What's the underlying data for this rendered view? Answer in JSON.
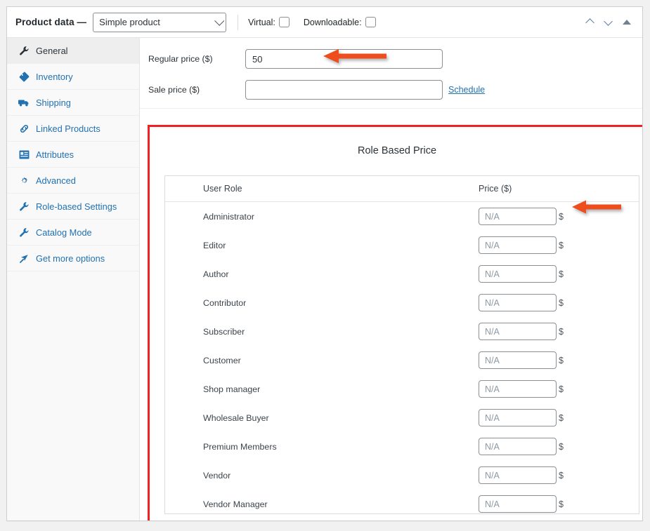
{
  "header": {
    "title": "Product data —",
    "product_type": "Simple product",
    "virtual_label": "Virtual:",
    "virtual_checked": false,
    "downloadable_label": "Downloadable:",
    "downloadable_checked": false,
    "controls": {
      "move_up": "move-up",
      "move_down": "move-down",
      "toggle": "toggle-panel"
    }
  },
  "sidebar": {
    "items": [
      {
        "label": "General",
        "icon": "wrench-icon",
        "active": true
      },
      {
        "label": "Inventory",
        "icon": "tag-icon",
        "active": false
      },
      {
        "label": "Shipping",
        "icon": "truck-icon",
        "active": false
      },
      {
        "label": "Linked Products",
        "icon": "link-icon",
        "active": false
      },
      {
        "label": "Attributes",
        "icon": "attributes-icon",
        "active": false
      },
      {
        "label": "Advanced",
        "icon": "gear-icon",
        "active": false
      },
      {
        "label": "Role-based Settings",
        "icon": "wrench-icon",
        "active": false
      },
      {
        "label": "Catalog Mode",
        "icon": "wrench-icon",
        "active": false
      },
      {
        "label": "Get more options",
        "icon": "cursor-icon",
        "active": false
      }
    ]
  },
  "general": {
    "regular_price_label": "Regular price ($)",
    "regular_price_value": "50",
    "regular_price_placeholder": "",
    "sale_price_label": "Sale price ($)",
    "sale_price_value": "",
    "sale_price_placeholder": "",
    "schedule_link": "Schedule"
  },
  "role_based_price": {
    "title": "Role Based Price",
    "columns": [
      "User Role",
      "Price ($)"
    ],
    "currency_symbol": "$",
    "price_placeholder": "N/A",
    "rows": [
      {
        "role": "Administrator",
        "price": ""
      },
      {
        "role": "Editor",
        "price": ""
      },
      {
        "role": "Author",
        "price": ""
      },
      {
        "role": "Contributor",
        "price": ""
      },
      {
        "role": "Subscriber",
        "price": ""
      },
      {
        "role": "Customer",
        "price": ""
      },
      {
        "role": "Shop manager",
        "price": ""
      },
      {
        "role": "Wholesale Buyer",
        "price": ""
      },
      {
        "role": "Premium Members",
        "price": ""
      },
      {
        "role": "Vendor",
        "price": ""
      },
      {
        "role": "Vendor Manager",
        "price": ""
      }
    ]
  },
  "annotations": {
    "highlight_color": "#ee2222",
    "arrow_color": "#ee4d1e",
    "arrows": [
      {
        "name": "arrow-regular-price"
      },
      {
        "name": "arrow-administrator-price"
      }
    ]
  }
}
